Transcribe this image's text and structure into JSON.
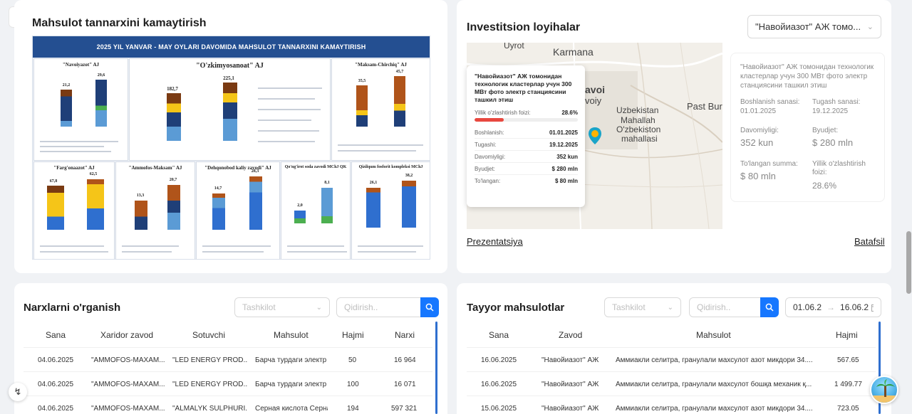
{
  "cost_card": {
    "title": "Mahsulot tannarxini kamaytirish",
    "banner": "2025 YIL YANVAR - MAY OYLARI DAVOMIDA MAHSULOT TANNARXINI KAMAYTIRISH",
    "panels": [
      {
        "name": "\"Navoiyazot\" AJ",
        "values": [
          "21,2",
          "29,6"
        ]
      },
      {
        "name": "\"O'zkimyosanoat\" AJ",
        "values": [
          "182,7",
          "225,1"
        ]
      },
      {
        "name": "\"Maksam-Chirchiq\" AJ",
        "values": [
          "35,5",
          "45,7"
        ]
      },
      {
        "name": "\"Farg'onaazot\" AJ",
        "values": [
          "67,8",
          "62,5"
        ]
      },
      {
        "name": "\"Ammofos-Maksam\" AJ",
        "values": [
          "13,3",
          "20,7"
        ]
      },
      {
        "name": "\"Dehqonobod kaliy zavodi\" AJ",
        "values": [
          "14,7",
          "28,3"
        ]
      },
      {
        "name": "Qo'ng'irot soda zavodi MChJ QK",
        "values": [
          "2,0",
          "8,1"
        ]
      },
      {
        "name": "Qizilqum fosforit kompleksi MChJ",
        "values": [
          "26,1",
          "38,2"
        ]
      }
    ]
  },
  "invest_card": {
    "title": "Investitsion loyihalar",
    "select_value": "\"Навойиазот\" АЖ томо...",
    "map_labels": [
      "Uyrot",
      "Karmana",
      "avoi",
      "voiy",
      "Uzbekistan",
      "Mahallah",
      "O'zbekiston",
      "mahallasi",
      "Past Burc"
    ],
    "popup": {
      "title": "\"Навойиазот\" АЖ томонидан технологик кластерлар учун 300 МВт фото электр станциясини ташкил этиш",
      "progress_label": "Yillik o'zlashtirish foizi:",
      "progress_value": "28.6%",
      "progress_fraction": 0.286,
      "rows": [
        {
          "label": "Boshlanish:",
          "value": "01.01.2025"
        },
        {
          "label": "Tugashi:",
          "value": "19.12.2025"
        },
        {
          "label": "Davomiyligi:",
          "value": "352 kun"
        },
        {
          "label": "Byudjet:",
          "value": "$ 280 mln"
        },
        {
          "label": "To'langan:",
          "value": "$ 80 mln"
        }
      ]
    },
    "details": {
      "title": "\"Навойиазот\" АЖ томонидан технологик кластерлар учун 300 МВт фото электр станциясини ташкил этиш",
      "start_label": "Boshlanish sanasi:",
      "start_value": "01.01.2025",
      "end_label": "Tugash sanasi:",
      "end_value": "19.12.2025",
      "duration_label": "Davomiyligi:",
      "duration_value": "352 kun",
      "budget_label": "Byudjet:",
      "budget_value": "$ 280 mln",
      "paid_label": "To'langan summa:",
      "paid_value": "$ 80 mln",
      "yearly_label": "Yillik o'zlashtirish foizi:",
      "yearly_value": "28.6%"
    },
    "link_left": "Prezentatsiya",
    "link_right": "Batafsil"
  },
  "prices_card": {
    "title": "Narxlarni o'rganish",
    "org_placeholder": "Tashkilot",
    "search_placeholder": "Qidirish..",
    "columns": [
      "Sana",
      "Xaridor zavod",
      "Sotuvchi",
      "Mahsulot",
      "Hajmi",
      "Narxi"
    ],
    "rows": [
      [
        "04.06.2025",
        "\"AMMOFOS-MAXAM...",
        "\"LED ENERGY PROD...",
        "Барча турдаги электр",
        "50",
        "16 964"
      ],
      [
        "04.06.2025",
        "\"AMMOFOS-MAXAM...",
        "\"LED ENERGY PROD...",
        "Барча турдаги электр",
        "100",
        "16 071"
      ],
      [
        "04.06.2025",
        "\"AMMOFOS-MAXAM...",
        "\"ALMALYK SULPHURI...",
        "Серная кислота Серна",
        "194",
        "597 321"
      ]
    ]
  },
  "products_card": {
    "title": "Tayyor mahsulotlar",
    "org_placeholder": "Tashkilot",
    "search_placeholder": "Qidirish..",
    "date_from": "01.06.2",
    "date_to": "16.06.2",
    "columns": [
      "Sana",
      "Zavod",
      "Mahsulot",
      "Hajmi"
    ],
    "rows": [
      [
        "16.06.2025",
        "\"Навойиазот\" АЖ",
        "Аммиакли селитра, гранулали махсулот азот микдори 34....",
        "567.65"
      ],
      [
        "16.06.2025",
        "\"Навойиазот\" АЖ",
        "Аммиакли селитра, гранулали махсулот бошқа механик қ...",
        "1 499.77"
      ],
      [
        "15.06.2025",
        "\"Навойиазот\" АЖ",
        "Аммиакли селитра, гранулали махсулот азот микдори 34....",
        "723.05"
      ]
    ]
  },
  "colors": {
    "accent": "#1677ff",
    "progress": "#e8483f",
    "banner": "#244f91"
  }
}
